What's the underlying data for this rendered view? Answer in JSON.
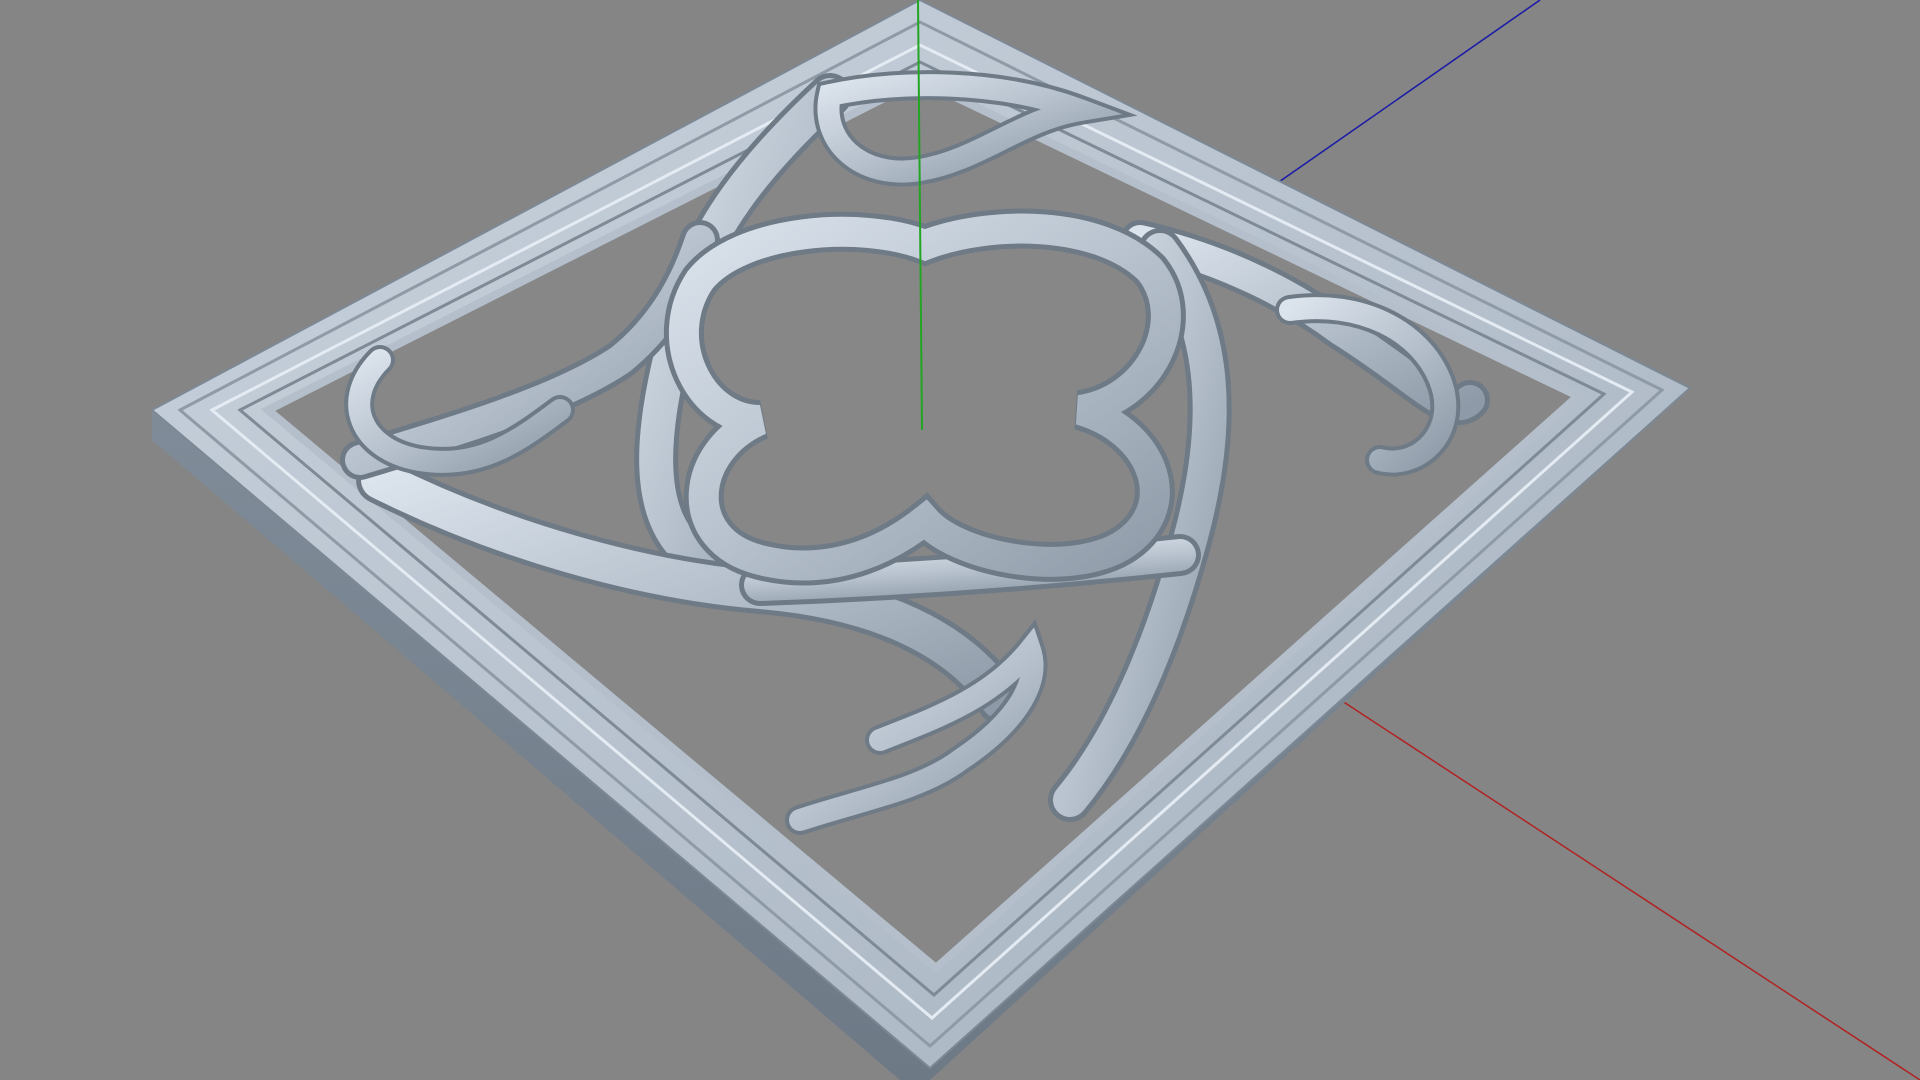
{
  "viewport": {
    "background_color": "#858585",
    "view": "perspective",
    "grid_visible": false
  },
  "axes": {
    "x_axis": {
      "color": "#b22222",
      "direction": "lower-right"
    },
    "y_axis": {
      "color": "#22a522",
      "direction": "up"
    },
    "z_axis": {
      "color": "#1a1aa8",
      "direction": "upper-right"
    }
  },
  "object": {
    "type": "square-frame-with-gothic-tracery",
    "material_color": "#aebac8",
    "highlight_color": "#d7e0ea",
    "shadow_color": "#6f7a87",
    "ornament_icon": "quatrefoil-icon",
    "lobes": 4,
    "corner_foils": 4
  }
}
